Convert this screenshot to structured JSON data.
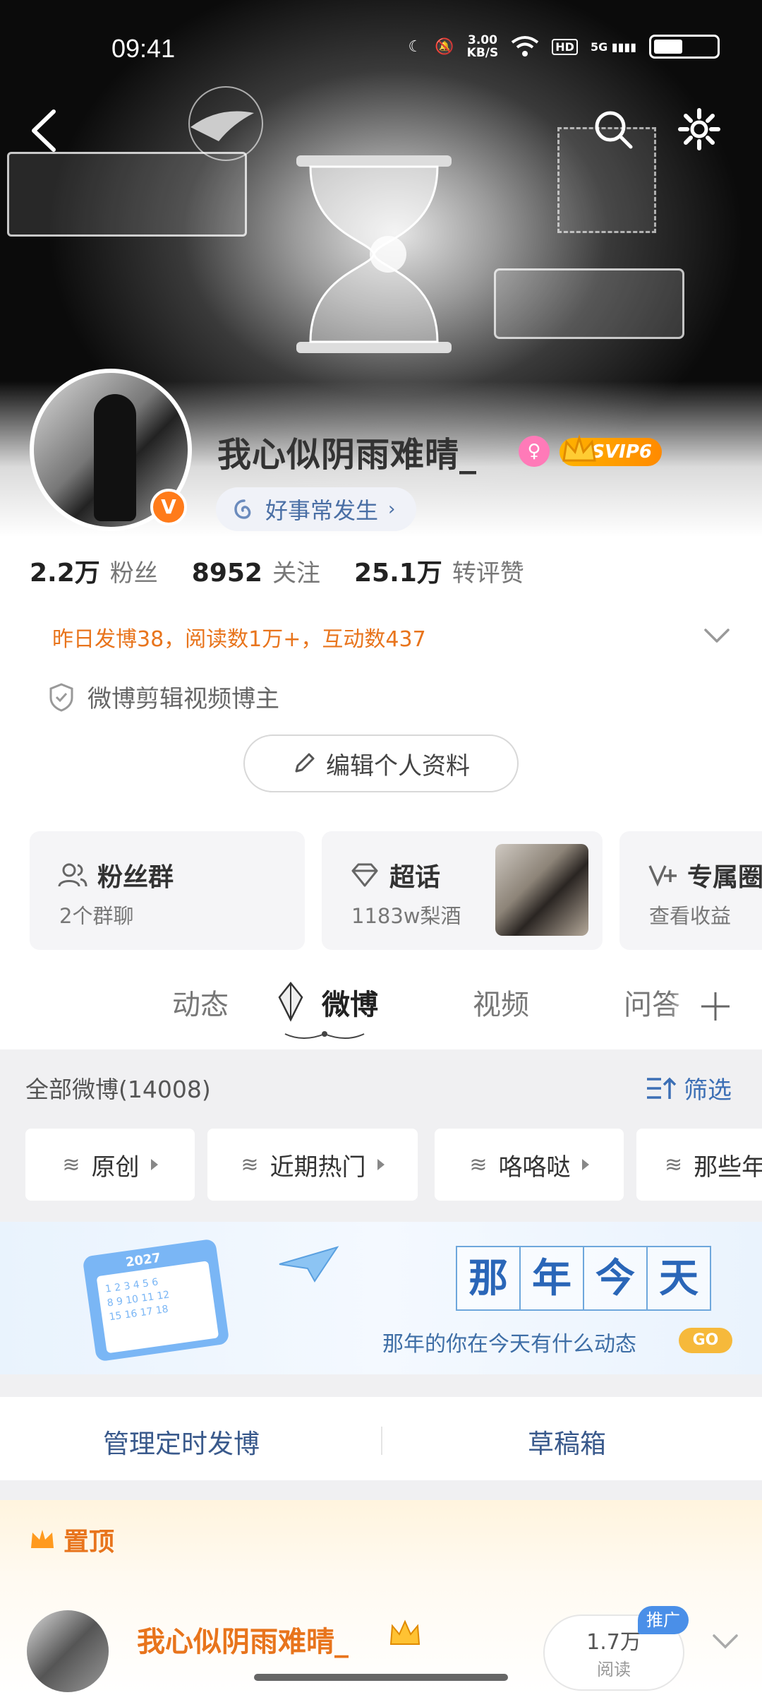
{
  "status_bar": {
    "time": "09:41",
    "net_speed_value": "3.00",
    "net_speed_unit": "KB/S",
    "hd": "HD",
    "signal": "5G"
  },
  "profile": {
    "username": "我心似阴雨难晴_",
    "svip": "SVIP6",
    "verified_mark": "V",
    "motto": "好事常发生",
    "stats": [
      {
        "num": "2.2万",
        "label": "粉丝"
      },
      {
        "num": "8952",
        "label": "关注"
      },
      {
        "num": "25.1万",
        "label": "转评赞"
      }
    ],
    "yesterday": "昨日发博38，阅读数1万+，互动数437",
    "certification": "微博剪辑视频博主",
    "edit_label": "编辑个人资料"
  },
  "cards": [
    {
      "title": "粉丝群",
      "sub": "2个群聊"
    },
    {
      "title": "超话",
      "sub": "1183w梨酒"
    },
    {
      "title": "专属圈",
      "sub": "查看收益"
    }
  ],
  "tabs": [
    "动态",
    "微博",
    "视频",
    "问答"
  ],
  "feed": {
    "filter_title": "全部微博(14008)",
    "filter_btn": "筛选",
    "chips": [
      "原创",
      "近期热门",
      "咯咯哒",
      "那些年"
    ],
    "banner": {
      "calendar_year": "2027",
      "chars": [
        "那",
        "年",
        "今",
        "天"
      ],
      "sub": "那年的你在今天有什么动态",
      "go": "GO"
    },
    "manage": [
      "管理定时发博",
      "草稿箱"
    ],
    "pinned_label": "置顶",
    "post": {
      "name": "我心似阴雨难晴_",
      "reads_num": "1.7万",
      "reads_label": "阅读",
      "promo": "推广"
    }
  },
  "colors": {
    "accent": "#e8741c",
    "link": "#3c6fb5",
    "svip": "#ff9a00",
    "bg_feed": "#f0f0f2"
  }
}
